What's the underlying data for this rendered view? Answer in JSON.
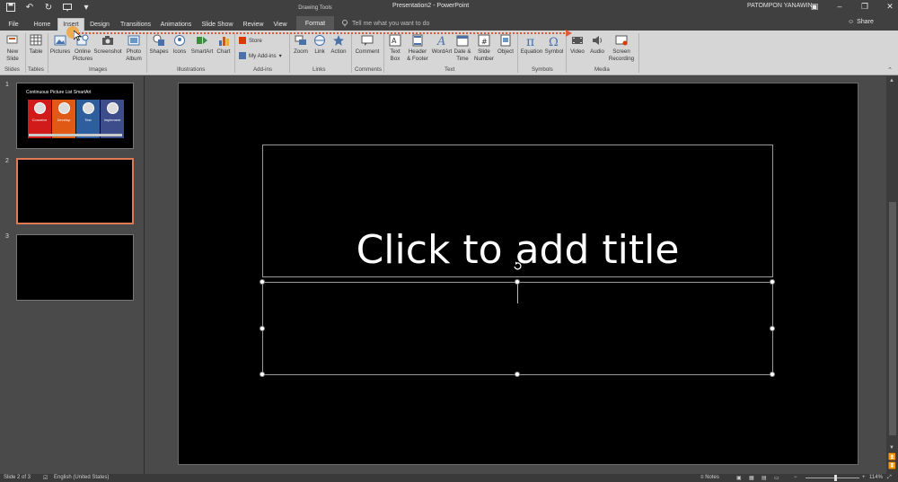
{
  "window": {
    "doc_title": "Presentation2 - PowerPoint",
    "context_group": "Drawing Tools",
    "user": "PATOMPON YANAWIN",
    "share": "Share"
  },
  "tabs": [
    "File",
    "Home",
    "Insert",
    "Design",
    "Transitions",
    "Animations",
    "Slide Show",
    "Review",
    "View",
    "Format"
  ],
  "active_tab": "Insert",
  "tell_me": "Tell me what you want to do",
  "ribbon": {
    "slides": {
      "new_slide": "New\nSlide",
      "group": "Slides"
    },
    "tables": {
      "table": "Table",
      "group": "Tables"
    },
    "images": {
      "pictures": "Pictures",
      "online_pictures": "Online\nPictures",
      "screenshot": "Screenshot",
      "photo_album": "Photo\nAlbum",
      "group": "Images"
    },
    "illustrations": {
      "shapes": "Shapes",
      "icons": "Icons",
      "smartart": "SmartArt",
      "chart": "Chart",
      "group": "Illustrations"
    },
    "addins": {
      "store": "Store",
      "my_addins": "My Add-ins",
      "group": "Add-ins"
    },
    "links": {
      "zoom": "Zoom",
      "link": "Link",
      "action": "Action",
      "group": "Links"
    },
    "comments": {
      "comment": "Comment",
      "group": "Comments"
    },
    "text": {
      "text_box": "Text\nBox",
      "header_footer": "Header\n& Footer",
      "wordart": "WordArt",
      "date_time": "Date &\nTime",
      "slide_number": "Slide\nNumber",
      "object": "Object",
      "group": "Text"
    },
    "symbols": {
      "equation": "Equation",
      "symbol": "Symbol",
      "group": "Symbols"
    },
    "media": {
      "video": "Video",
      "audio": "Audio",
      "screen_recording": "Screen\nRecording",
      "group": "Media"
    }
  },
  "thumbnails": [
    {
      "num": "1",
      "title": "Continuous Picture List SmartArt",
      "items": [
        "Conceive",
        "Develop",
        "Test",
        "Implement"
      ],
      "colors": [
        "#d11a1a",
        "#e05a16",
        "#2e5e9e",
        "#3d4d8c"
      ]
    },
    {
      "num": "2"
    },
    {
      "num": "3"
    }
  ],
  "slide": {
    "title_placeholder": "Click to add title"
  },
  "status": {
    "slide_info": "Slide 2 of 3",
    "language": "English (United States)",
    "notes": "Notes",
    "zoom": "114%"
  },
  "colors": {
    "accent": "#e07a55",
    "annotation": "#e05a3a"
  }
}
